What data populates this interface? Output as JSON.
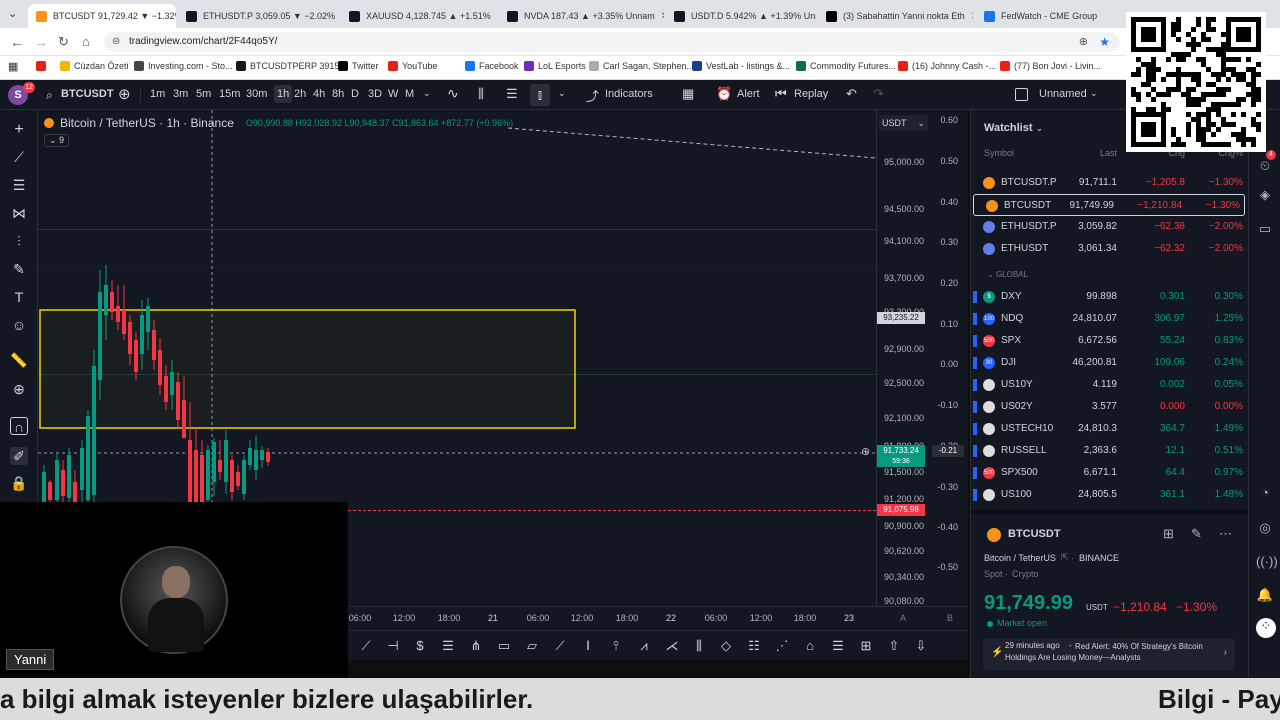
{
  "browser": {
    "tabs": [
      {
        "title": "BTCUSDT 91,729.42 ▼ −1.32%",
        "color": "#f7931a",
        "active": true
      },
      {
        "title": "ETHUSDT.P 3,059.05 ▼ −2.02%",
        "color": "#131722"
      },
      {
        "title": "XAUUSD 4,128.745 ▲ +1.51%",
        "color": "#131722"
      },
      {
        "title": "NVDA 187.43 ▲ +3.35% Unnam",
        "color": "#131722"
      },
      {
        "title": "USDT.D 5.942% ▲ +1.39% Unn",
        "color": "#131722"
      },
      {
        "title": "(3) Sabahattin Yanni nokta Eth",
        "color": "#000000"
      },
      {
        "title": "FedWatch - CME Group",
        "color": "#1a73e8"
      }
    ],
    "url": "tradingview.com/chart/2F44qo5Y/",
    "bookmarks": [
      {
        "label": "",
        "color": "#e62117"
      },
      {
        "label": "Cüzdan Özeti",
        "color": "#f2b705"
      },
      {
        "label": "Investing.com - Sto...",
        "color": "#444"
      },
      {
        "label": "BTCUSDTPERP 3915...",
        "color": "#131722"
      },
      {
        "label": "Twitter",
        "color": "#000"
      },
      {
        "label": "YouTube",
        "color": "#e62117"
      },
      {
        "label": "Facebook",
        "color": "#1877f2"
      },
      {
        "label": "LoL Esports",
        "color": "#6f2dbd"
      },
      {
        "label": "Carl Sagan, Stephen...",
        "color": "#aaa"
      },
      {
        "label": "VestLab - listings &...",
        "color": "#1a3e8c"
      },
      {
        "label": "Commodity Futures...",
        "color": "#0a6e4f"
      },
      {
        "label": "(16) Johnny Cash -...",
        "color": "#e62117"
      },
      {
        "label": "(77) Bon Jovi - Livin...",
        "color": "#e62117"
      }
    ]
  },
  "toolbar": {
    "avatar_letter": "S",
    "avatar_badge": "12",
    "symbol": "BTCUSDT",
    "intervals": [
      "1m",
      "3m",
      "5m",
      "15m",
      "30m",
      "1h",
      "2h",
      "4h",
      "8h",
      "D",
      "3D",
      "W",
      "M"
    ],
    "active_interval": "1h",
    "indicators": "Indicators",
    "alert": "Alert",
    "replay": "Replay",
    "layout_name": "Unnamed"
  },
  "chart": {
    "title": "Bitcoin / TetherUS · 1h · Binance",
    "ohlc": "O90,990.88 H92,028.92 L90,948.37 C91,863.64 +872.77 (+0.96%)",
    "indicator_count": "9",
    "currency": "USDT",
    "price_ticks": [
      "95,000.00",
      "94,500.00",
      "94,100.00",
      "93,700.00",
      "93,300.00",
      "92,900.00",
      "92,500.00",
      "92,100.00",
      "91,800.00",
      "91,500.00",
      "91,200.00",
      "90,900.00",
      "90,620.00",
      "90,340.00",
      "90,080.00"
    ],
    "pct_ticks": [
      "0.60",
      "0.50",
      "0.40",
      "0.30",
      "0.20",
      "0.10",
      "0.00",
      "-0.10",
      "-0.20",
      "-0.30",
      "-0.40",
      "-0.50"
    ],
    "box_label": "93,235.22",
    "current_price": "91,733.24",
    "countdown": "59:36",
    "current_pct": "-0.21",
    "alert_price": "91,075.98",
    "time_labels": [
      "06:00",
      "12:00",
      "18:00",
      "21",
      "06:00",
      "12:00",
      "18:00",
      "22",
      "06:00",
      "12:00",
      "18:00",
      "23"
    ],
    "axis_extra": [
      "A",
      "B"
    ]
  },
  "watchlist": {
    "title": "Watchlist",
    "headers": [
      "Symbol",
      "Last",
      "Chg",
      "Chg%"
    ],
    "rows": [
      {
        "symbol": "BTCUSDT.P",
        "last": "91,711.1",
        "chg": "−1,205.8",
        "pct": "−1.30%",
        "dir": "neg",
        "icon": "#f7931a",
        "selected": false
      },
      {
        "symbol": "BTCUSDT",
        "last": "91,749.99",
        "chg": "−1,210.84",
        "pct": "−1.30%",
        "dir": "neg",
        "icon": "#f7931a",
        "selected": true
      },
      {
        "symbol": "ETHUSDT.P",
        "last": "3,059.82",
        "chg": "−62.38",
        "pct": "−2.00%",
        "dir": "neg",
        "icon": "#627eea",
        "selected": false
      },
      {
        "symbol": "ETHUSDT",
        "last": "3,061.34",
        "chg": "−62.32",
        "pct": "−2.00%",
        "dir": "neg",
        "icon": "#627eea",
        "selected": false
      }
    ],
    "section": "GLOBAL",
    "global_rows": [
      {
        "symbol": "DXY",
        "last": "99.898",
        "chg": "0.301",
        "pct": "0.30%",
        "dir": "pos",
        "icon": "#089981",
        "icon_text": "$"
      },
      {
        "symbol": "NDQ",
        "last": "24,810.07",
        "chg": "306.97",
        "pct": "1.25%",
        "dir": "pos",
        "icon": "#2962ff",
        "icon_text": "100"
      },
      {
        "symbol": "SPX",
        "last": "6,672.56",
        "chg": "55.24",
        "pct": "0.83%",
        "dir": "pos",
        "icon": "#f23645",
        "icon_text": "500"
      },
      {
        "symbol": "DJI",
        "last": "46,200.81",
        "chg": "109.06",
        "pct": "0.24%",
        "dir": "pos",
        "icon": "#2962ff",
        "icon_text": "30"
      },
      {
        "symbol": "US10Y",
        "last": "4.119",
        "chg": "0.002",
        "pct": "0.05%",
        "dir": "pos",
        "icon": "#ddd",
        "icon_text": ""
      },
      {
        "symbol": "US02Y",
        "last": "3.577",
        "chg": "0.000",
        "pct": "0.00%",
        "dir": "neg",
        "icon": "#ddd",
        "icon_text": ""
      },
      {
        "symbol": "USTECH10",
        "last": "24,810.3",
        "chg": "364.7",
        "pct": "1.49%",
        "dir": "pos",
        "icon": "#ddd",
        "icon_text": ""
      },
      {
        "symbol": "RUSSELL",
        "last": "2,363.6",
        "chg": "12.1",
        "pct": "0.51%",
        "dir": "pos",
        "icon": "#ddd",
        "icon_text": ""
      },
      {
        "symbol": "SPX500",
        "last": "6,671.1",
        "chg": "64.4",
        "pct": "0.97%",
        "dir": "pos",
        "icon": "#f23645",
        "icon_text": "500"
      },
      {
        "symbol": "US100",
        "last": "24,805.5",
        "chg": "361.1",
        "pct": "1.48%",
        "dir": "pos",
        "icon": "#ddd",
        "icon_text": ""
      }
    ]
  },
  "details": {
    "symbol": "BTCUSDT",
    "name": "Bitcoin / TetherUS",
    "exchange": "BINANCE",
    "type": "Spot",
    "category": "Crypto",
    "price": "91,749.99",
    "currency": "USDT",
    "chg": "−1,210.84",
    "pct": "−1.30%",
    "status": "Market open",
    "news_time": "29 minutes ago",
    "news_text": "Red Alert: 40% Of Strategy's Bitcoin Holdings Are Losing Money—Analysts"
  },
  "right_strip_badge": "4",
  "stream": {
    "name": "Yanni",
    "ticker_left": "a bilgi almak isteyenler bizlere ulaşabilirler.",
    "ticker_right": "Bilgi - Pay"
  }
}
